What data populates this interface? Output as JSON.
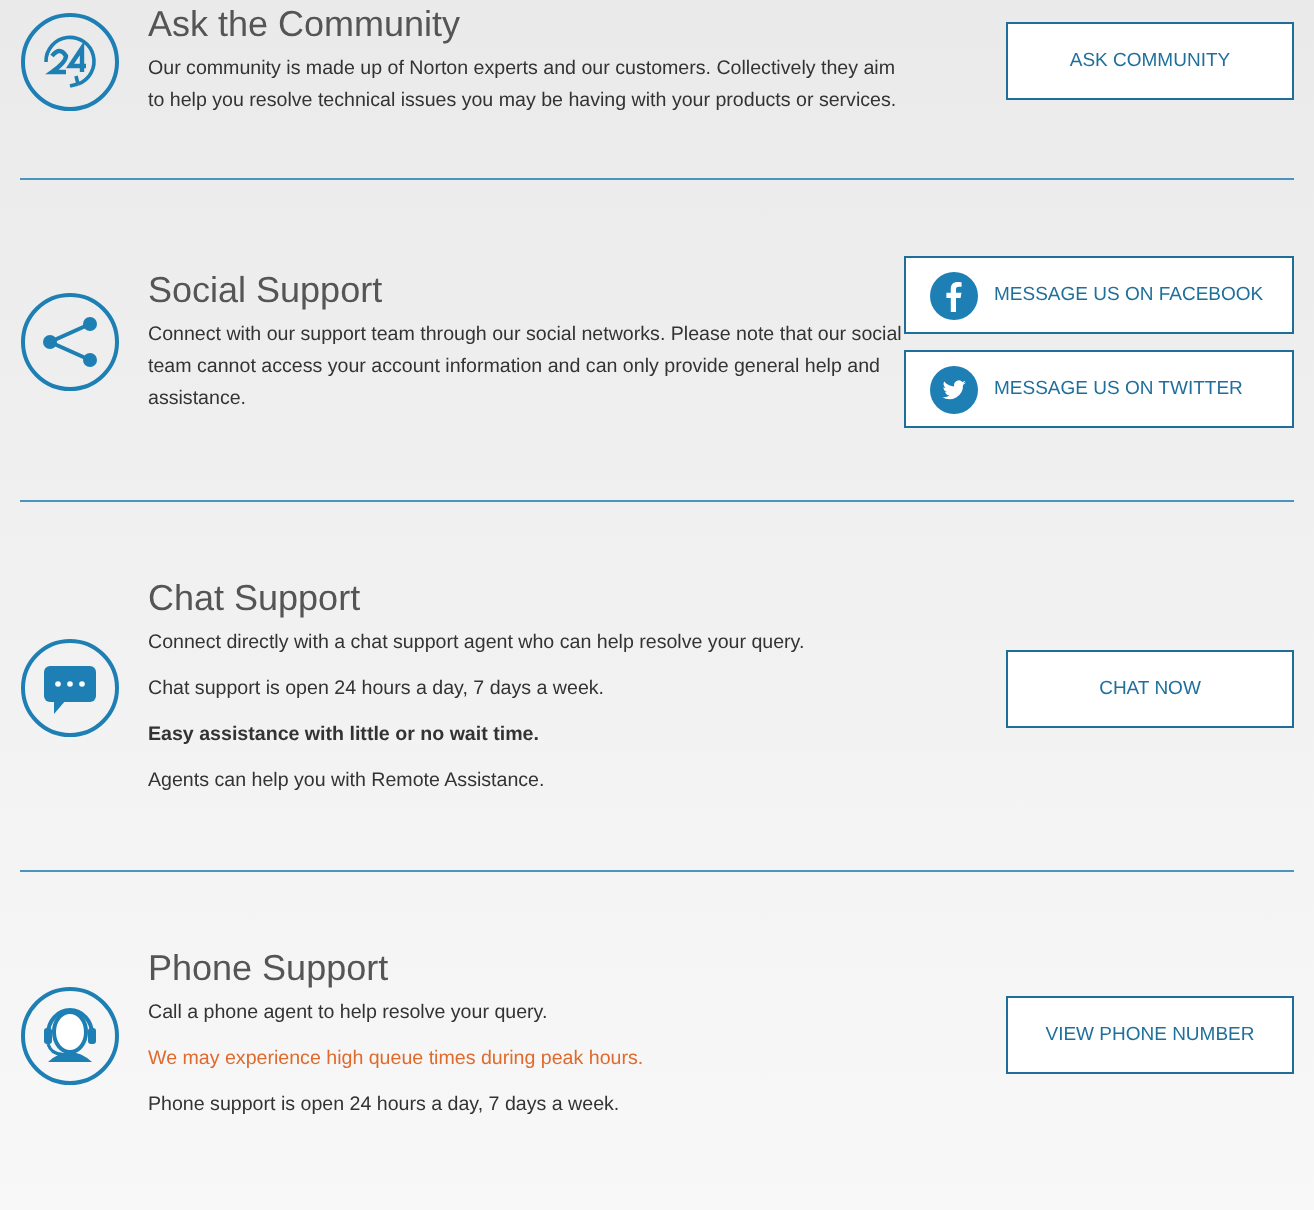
{
  "sections": [
    {
      "kind": "clock-24",
      "title": "Ask the Community",
      "paragraphs": [
        {
          "kind": "plain",
          "text": "Our community is made up of Norton experts and our customers. Collectively they aim to help you resolve technical issues you may be having with your products or services."
        }
      ],
      "buttons": [
        {
          "kind": "plain",
          "label": "ASK COMMUNITY"
        }
      ]
    },
    {
      "kind": "share",
      "title": "Social Support",
      "paragraphs": [
        {
          "kind": "plain",
          "text": "Connect with our support team through our social networks. Please note that our social team cannot access your account information and can only provide general help and assistance."
        }
      ],
      "buttons": [
        {
          "kind": "facebook",
          "label": "MESSAGE US ON FACEBOOK"
        },
        {
          "kind": "twitter",
          "label": "MESSAGE US ON TWITTER"
        }
      ]
    },
    {
      "kind": "chat",
      "title": "Chat Support",
      "paragraphs": [
        {
          "kind": "plain",
          "text": "Connect directly with a chat support agent who can help resolve your query."
        },
        {
          "kind": "plain",
          "text": "Chat support is open 24 hours a day, 7 days a week."
        },
        {
          "kind": "bold",
          "text": "Easy assistance with little or no wait time."
        },
        {
          "kind": "plain",
          "text": "Agents can help you with Remote Assistance."
        }
      ],
      "buttons": [
        {
          "kind": "plain",
          "label": "CHAT NOW"
        }
      ]
    },
    {
      "kind": "headset",
      "title": "Phone Support",
      "paragraphs": [
        {
          "kind": "plain",
          "text": "Call a phone agent to help resolve your query."
        },
        {
          "kind": "warning",
          "text": "We may experience high queue times during peak hours."
        },
        {
          "kind": "plain",
          "text": "Phone support is open 24 hours a day, 7 days a week."
        }
      ],
      "buttons": [
        {
          "kind": "plain",
          "label": "VIEW PHONE NUMBER"
        }
      ]
    }
  ]
}
